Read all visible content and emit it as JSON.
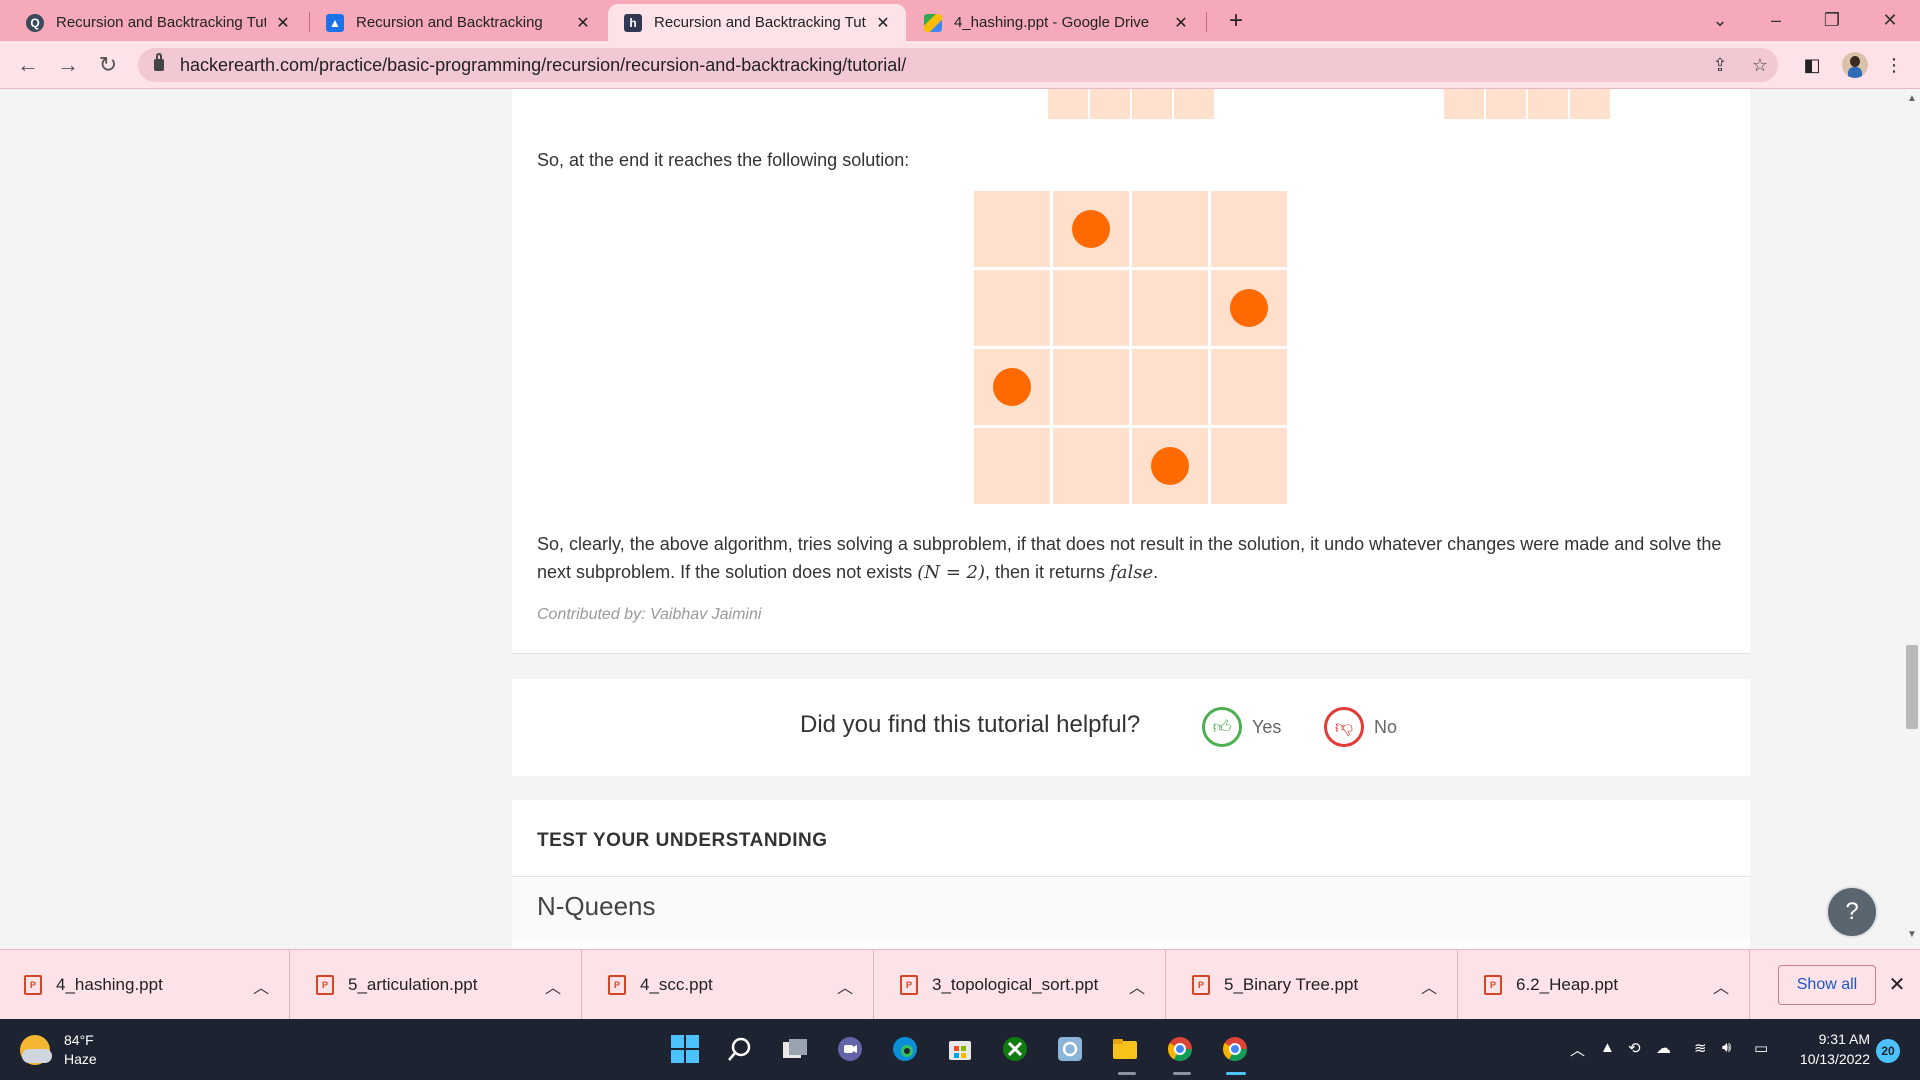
{
  "browser": {
    "tabs": [
      {
        "title": "Recursion and Backtracking Tuto",
        "active": false
      },
      {
        "title": "Recursion and Backtracking",
        "active": false
      },
      {
        "title": "Recursion and Backtracking Tuto",
        "active": true
      },
      {
        "title": "4_hashing.ppt - Google Drive",
        "active": false
      }
    ],
    "new_tab_label": "+",
    "url": "hackerearth.com/practice/basic-programming/recursion/recursion-and-backtracking/tutorial/"
  },
  "article": {
    "intro": "So, at the end it reaches the following solution:",
    "board": {
      "size": 4,
      "queens_by_row_col": [
        [
          0,
          1
        ],
        [
          1,
          3
        ],
        [
          2,
          0
        ],
        [
          3,
          2
        ]
      ],
      "tile_color": "#ffe0cc",
      "queen_color": "#ff6a00"
    },
    "conclusion_part1": "So, clearly, the above algorithm, tries solving a subproblem, if that does not result in the solution, it undo whatever changes were made and solve the next subproblem. If the solution does not exists ",
    "conclusion_math1": "(N = 2)",
    "conclusion_part2": ", then it returns ",
    "conclusion_math2": "false",
    "conclusion_end": ".",
    "contributor": "Contributed by: Vaibhav Jaimini"
  },
  "feedback": {
    "question": "Did you find this tutorial helpful?",
    "yes_label": "Yes",
    "no_label": "No"
  },
  "test": {
    "heading": "TEST YOUR UNDERSTANDING",
    "problem_title": "N-Queens"
  },
  "help_label": "?",
  "downloads": {
    "items": [
      "4_hashing.ppt",
      "5_articulation.ppt",
      "4_scc.ppt",
      "3_topological_sort.ppt",
      "5_Binary Tree.ppt",
      "6.2_Heap.ppt"
    ],
    "show_all_label": "Show all"
  },
  "taskbar": {
    "temperature": "84°F",
    "condition": "Haze",
    "time": "9:31 AM",
    "date": "10/13/2022",
    "notifications": "20"
  }
}
